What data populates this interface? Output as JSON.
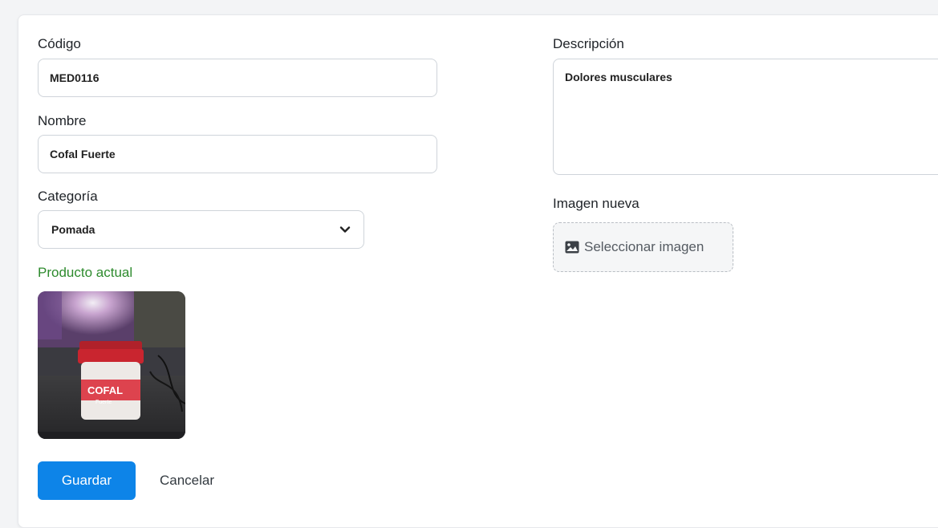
{
  "form": {
    "code": {
      "label": "Código",
      "value": "MED0116"
    },
    "name": {
      "label": "Nombre",
      "value": "Cofal Fuerte"
    },
    "category": {
      "label": "Categoría",
      "selected": "Pomada"
    },
    "current_product": {
      "label": "Producto actual"
    },
    "description": {
      "label": "Descripción",
      "value": "Dolores musculares"
    },
    "new_image": {
      "label": "Imagen nueva",
      "button_label": "Seleccionar imagen"
    },
    "actions": {
      "save_label": "Guardar",
      "cancel_label": "Cancelar"
    }
  },
  "colors": {
    "primary": "#0d84e8",
    "success_text": "#2e8b2e",
    "border": "#cfd4da"
  },
  "icons": {
    "select_chevron": "chevron-down-icon",
    "file_button": "image-icon"
  }
}
